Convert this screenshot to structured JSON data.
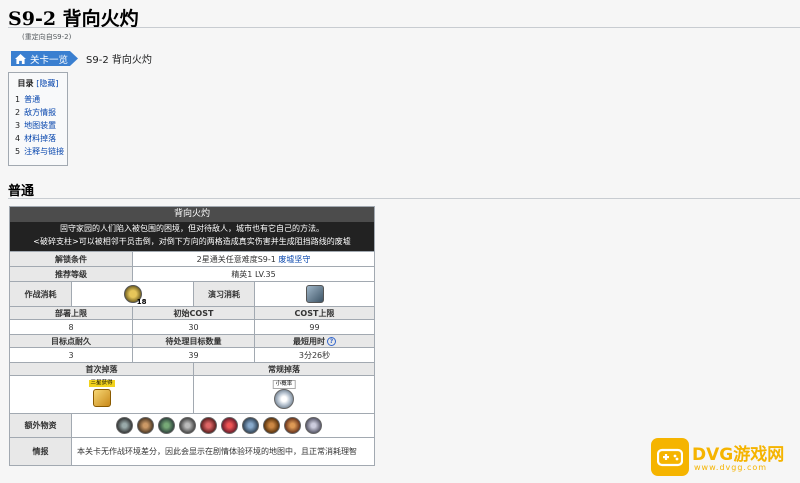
{
  "page": {
    "title": "S9-2 背向火灼",
    "redirect_note": "(重定向自S9-2)"
  },
  "breadcrumb": {
    "home_label": "关卡一览",
    "current": "S9-2 背向火灼"
  },
  "toc": {
    "title": "目录",
    "hide_label": "[隐藏]",
    "items": [
      {
        "num": "1",
        "label": "普通"
      },
      {
        "num": "2",
        "label": "敌方情报"
      },
      {
        "num": "3",
        "label": "地图装置"
      },
      {
        "num": "4",
        "label": "材料掉落"
      },
      {
        "num": "5",
        "label": "注释与链接"
      }
    ]
  },
  "section": {
    "title": "普通"
  },
  "stage": {
    "name": "背向火灼",
    "desc_line1": "固守家园的人们陷入被包围的困境，但对待敌人，城市也有它自己的方法。",
    "desc_line2": "<破碎支柱>可以被相邻干员击倒，对倒下方向的两格造成真实伤害并生成阻挡路线的废墟",
    "unlock_label": "解锁条件",
    "unlock_prefix": "2星通关任意难度S9-1",
    "unlock_link": "废墟坚守",
    "recommend_label": "推荐等级",
    "recommend_value": "精英1 LV.35",
    "sanity_label": "作战消耗",
    "sanity_value": "18",
    "practice_label": "演习消耗",
    "deploy_label": "部署上限",
    "deploy_value": "8",
    "cost_label": "初始COST",
    "cost_value": "30",
    "cost_max_label": "COST上限",
    "cost_max_value": "99",
    "hp_label": "目标点耐久",
    "hp_value": "3",
    "enemy_label": "待处理目标数量",
    "enemy_value": "39",
    "time_label": "最短用时",
    "time_help": "?",
    "time_value": "3分26秒",
    "first_drop_label": "首次掉落",
    "first_drop_tag": "三星获得",
    "regular_drop_label": "常规掉落",
    "regular_drop_tag": "小概率",
    "extra_label": "额外物资",
    "extra_icons": [
      "orundum-icon",
      "device-icon",
      "polyketon-icon",
      "sugar-icon",
      "oriron-icon",
      "aketon-icon",
      "chip-icon",
      "ester-icon",
      "crystal-icon",
      "manganese-icon"
    ],
    "intel_label": "情报",
    "intel_value": "本关卡无作战环境差分，因此会显示在剧情体验环境的地图中，且正常消耗理智"
  },
  "watermark": {
    "brand": "DVG游戏网",
    "url": "www.dvgg.com",
    "color": "#f5b400"
  },
  "colors": {
    "link": "#0645ad",
    "header_bg": "#222222",
    "breadcrumb_bg": "#3a7fd0"
  }
}
